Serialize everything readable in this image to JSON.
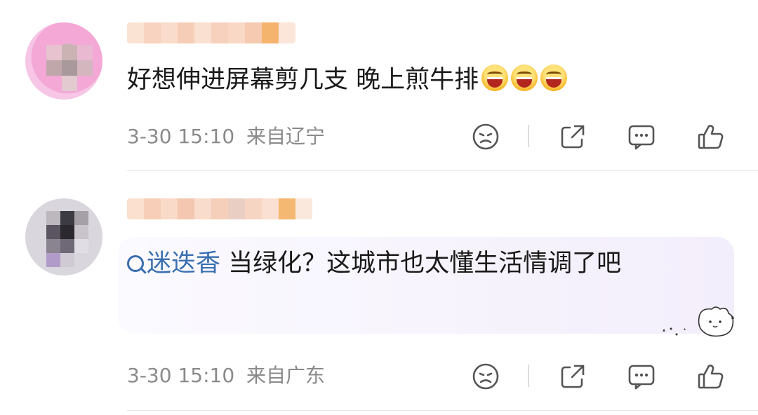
{
  "comments": [
    {
      "text": "好想伸进屏幕剪几支 晚上煎牛排",
      "emojis": [
        "laugh-emoji",
        "laugh-emoji",
        "laugh-emoji"
      ],
      "time": "3-30 15:10",
      "location": "来自辽宁"
    },
    {
      "topic": "迷迭香",
      "text": " 当绿化？这城市也太懂生活情调了吧",
      "time": "3-30 15:10",
      "location": "来自广东"
    }
  ],
  "colors": {
    "topic_link": "#3a6fb0",
    "meta_gray": "#8a8a8a",
    "bubble_bg": "#f3eefb"
  },
  "icons": [
    "sad-face-icon",
    "share-icon",
    "comment-icon",
    "like-icon"
  ]
}
